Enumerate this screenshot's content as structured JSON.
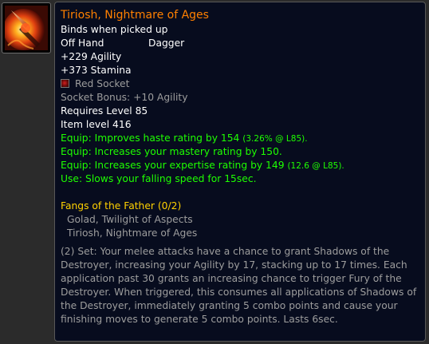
{
  "item": {
    "icon": "dagger-item-icon",
    "name": "Tiriosh, Nightmare of Ages",
    "binding": "Binds when picked up",
    "slot": "Off Hand",
    "type": "Dagger",
    "stats": [
      "+229 Agility",
      "+373 Stamina"
    ],
    "socket": {
      "label": "Red Socket",
      "icon": "red-socket-icon"
    },
    "socket_bonus": "Socket Bonus: +10 Agility",
    "requires_level": "Requires Level 85",
    "item_level": "Item level 416",
    "equip_effects": [
      {
        "text": "Equip: Improves haste rating by 154",
        "note": "(3.26% @ L85)."
      },
      {
        "text": "Equip: Increases your mastery rating by 150.",
        "note": ""
      },
      {
        "text": "Equip: Increases your expertise rating by 149",
        "note": "(12.6 @ L85)."
      },
      {
        "text": "Use: Slows your falling speed for 15sec.",
        "note": ""
      }
    ],
    "set": {
      "name": "Fangs of the Father (0/2)",
      "items": [
        "Golad, Twilight of Aspects",
        "Tiriosh, Nightmare of Ages"
      ],
      "bonus": "(2) Set: Your melee attacks have a chance to grant Shadows of the Destroyer, increasing your Agility by 17, stacking up to 17 times. Each application past 30 grants an increasing chance to trigger Fury of the Destroyer. When triggered, this consumes all applications of Shadows of the Destroyer, immediately granting 5 combo points and cause your finishing moves to generate 5 combo points. Lasts 6sec."
    }
  },
  "colors": {
    "legendary_name": "#ff8000",
    "equip_green": "#1eff00",
    "set_gold": "#ffd100",
    "inactive_grey": "#9d9d9d",
    "tooltip_bg": "#070c1e"
  }
}
